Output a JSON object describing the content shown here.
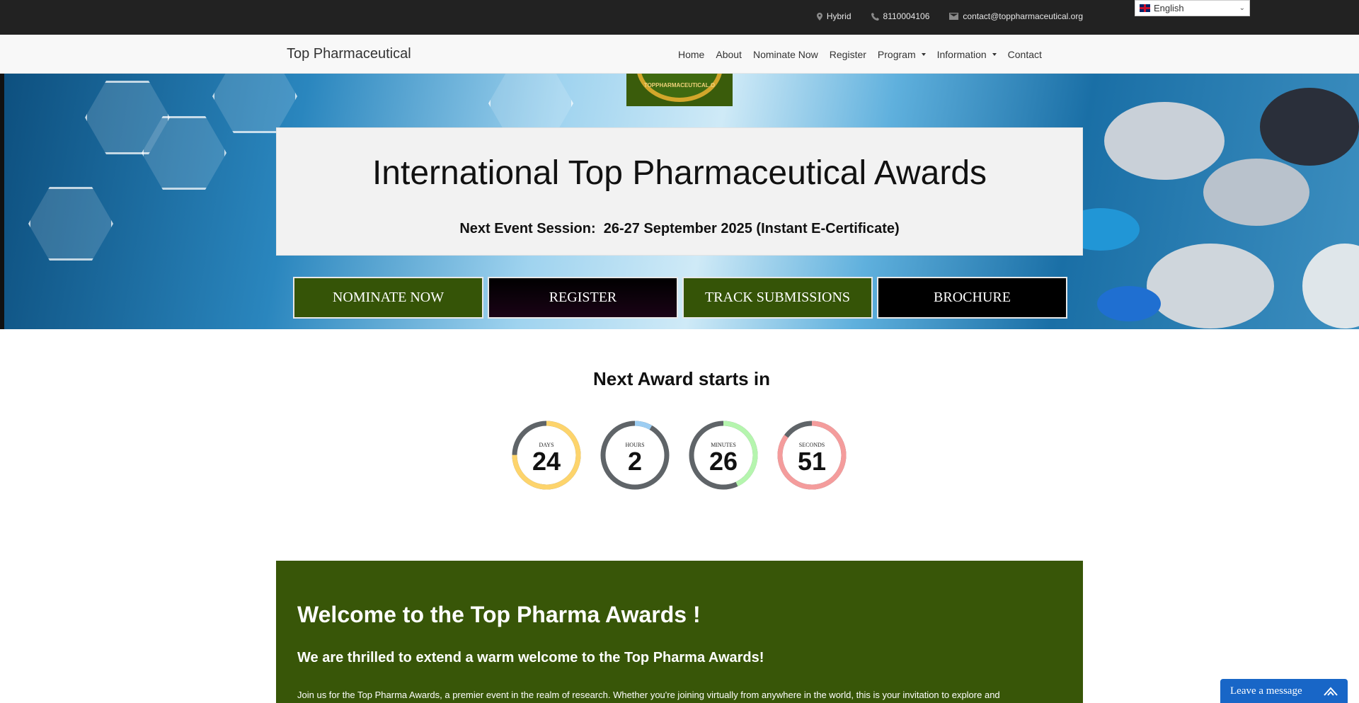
{
  "topbar": {
    "location": "Hybrid",
    "phone": "8110004106",
    "email": "contact@toppharmaceutical.org",
    "language": "English"
  },
  "navbar": {
    "brand": "Top Pharmaceutical",
    "items": [
      {
        "label": "Home",
        "dropdown": false
      },
      {
        "label": "About",
        "dropdown": false
      },
      {
        "label": "Nominate Now",
        "dropdown": false
      },
      {
        "label": "Register",
        "dropdown": false
      },
      {
        "label": "Program",
        "dropdown": true
      },
      {
        "label": "Information",
        "dropdown": true
      },
      {
        "label": "Contact",
        "dropdown": false
      }
    ]
  },
  "hero": {
    "logo_text": "TOPPHARMACEUTICAL.O",
    "title": "International Top Pharmaceutical Awards",
    "session": "Next Event Session:  26-27 September 2025 (Instant E-Certificate)",
    "buttons": {
      "nominate": "NOMINATE NOW",
      "register": "REGISTER",
      "track": "TRACK SUBMISSIONS",
      "brochure": "BROCHURE"
    }
  },
  "countdown": {
    "title": "Next Award starts in",
    "units": [
      {
        "label": "DAYS",
        "value": "24",
        "color": "#fdd46c",
        "fraction": 0.75
      },
      {
        "label": "HOURS",
        "value": "2",
        "color": "#9ccdf2",
        "fraction": 0.083
      },
      {
        "label": "MINUTES",
        "value": "26",
        "color": "#b5f5ae",
        "fraction": 0.43
      },
      {
        "label": "SECONDS",
        "value": "51",
        "color": "#f49c9c",
        "fraction": 0.85
      }
    ]
  },
  "welcome": {
    "heading": "Welcome to the Top Pharma Awards !",
    "subheading": "We are thrilled to extend a warm welcome to the Top Pharma Awards!",
    "body": "Join us for the Top Pharma Awards, a premier event in the realm of research. Whether you're joining virtually from anywhere in the world, this is your invitation to explore and"
  },
  "chat": {
    "label": "Leave a message"
  },
  "colors": {
    "topbar": "#222222",
    "brand_green": "#355407",
    "chat_blue": "#1866c7"
  }
}
